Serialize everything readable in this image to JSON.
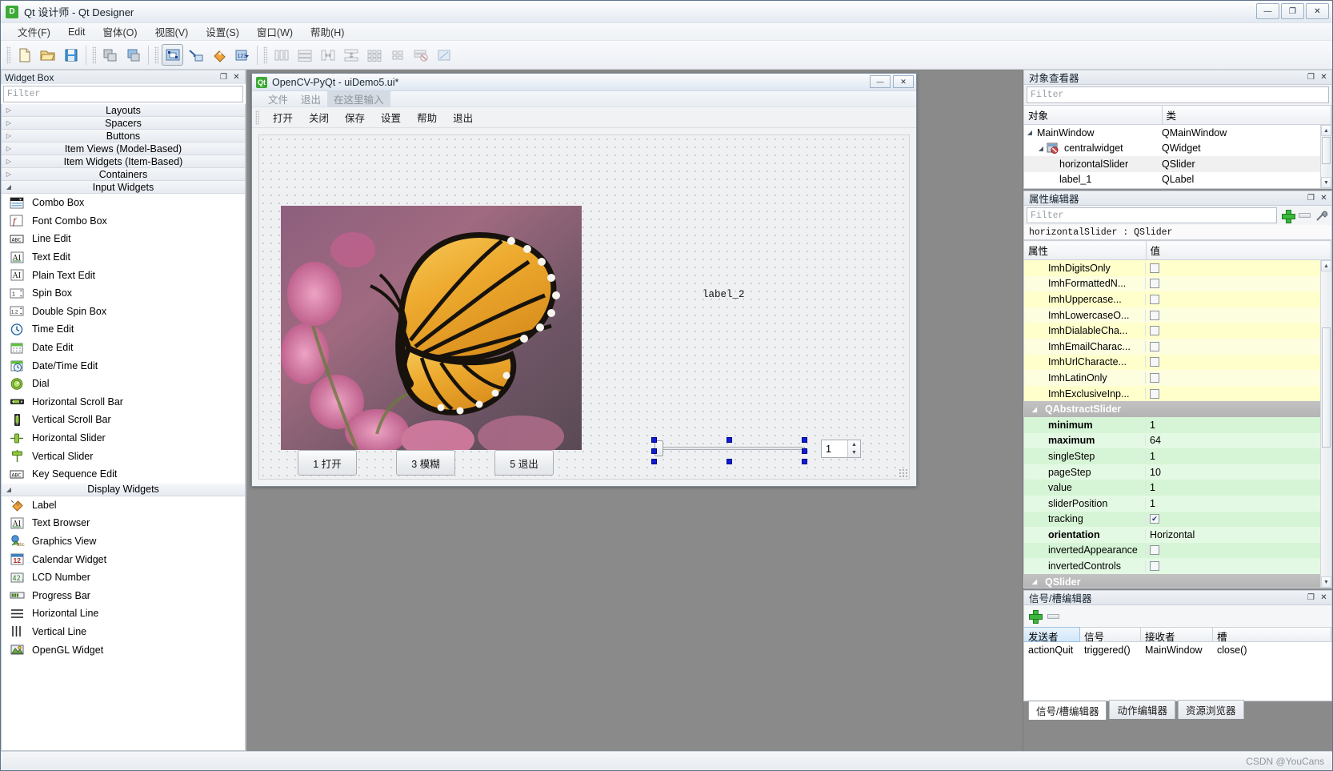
{
  "window": {
    "title": "Qt 设计师 - Qt Designer",
    "logo_text": "D",
    "minimize": "—",
    "maximize": "❐",
    "close": "✕"
  },
  "menubar": {
    "items": [
      {
        "label": "文件(F)"
      },
      {
        "label": "Edit"
      },
      {
        "label": "窗体(O)"
      },
      {
        "label": "视图(V)"
      },
      {
        "label": "设置(S)"
      },
      {
        "label": "窗口(W)"
      },
      {
        "label": "帮助(H)"
      }
    ]
  },
  "toolbar": {
    "icons": [
      "new-form-icon",
      "open-form-icon",
      "save-form-icon",
      "copy-icon",
      "paste-icon",
      "edit-widgets-icon",
      "edit-signals-icon",
      "edit-buddies-icon",
      "edit-tab-order-icon",
      "layout-horizontally-icon",
      "layout-vertically-icon",
      "layout-splitter-h-icon",
      "layout-splitter-v-icon",
      "layout-grid-icon",
      "layout-form-icon",
      "break-layout-icon",
      "adjust-size-icon"
    ]
  },
  "widget_box": {
    "title": "Widget Box",
    "float_btn": "❐",
    "close_btn": "✕",
    "filter_placeholder": "Filter",
    "groups": [
      {
        "label": "Layouts",
        "expanded": false,
        "items": []
      },
      {
        "label": "Spacers",
        "expanded": false,
        "items": []
      },
      {
        "label": "Buttons",
        "expanded": false,
        "items": []
      },
      {
        "label": "Item Views (Model-Based)",
        "expanded": false,
        "items": []
      },
      {
        "label": "Item Widgets (Item-Based)",
        "expanded": false,
        "items": []
      },
      {
        "label": "Containers",
        "expanded": false,
        "items": []
      },
      {
        "label": "Input Widgets",
        "expanded": true,
        "items": [
          {
            "label": "Combo Box",
            "icon": "combo-box-icon"
          },
          {
            "label": "Font Combo Box",
            "icon": "font-combo-box-icon"
          },
          {
            "label": "Line Edit",
            "icon": "line-edit-icon"
          },
          {
            "label": "Text Edit",
            "icon": "text-edit-icon"
          },
          {
            "label": "Plain Text Edit",
            "icon": "plain-text-edit-icon"
          },
          {
            "label": "Spin Box",
            "icon": "spin-box-icon"
          },
          {
            "label": "Double Spin Box",
            "icon": "double-spin-box-icon"
          },
          {
            "label": "Time Edit",
            "icon": "time-edit-icon"
          },
          {
            "label": "Date Edit",
            "icon": "date-edit-icon"
          },
          {
            "label": "Date/Time Edit",
            "icon": "date-time-edit-icon"
          },
          {
            "label": "Dial",
            "icon": "dial-icon"
          },
          {
            "label": "Horizontal Scroll Bar",
            "icon": "horizontal-scroll-bar-icon"
          },
          {
            "label": "Vertical Scroll Bar",
            "icon": "vertical-scroll-bar-icon"
          },
          {
            "label": "Horizontal Slider",
            "icon": "horizontal-slider-icon"
          },
          {
            "label": "Vertical Slider",
            "icon": "vertical-slider-icon"
          },
          {
            "label": "Key Sequence Edit",
            "icon": "key-sequence-edit-icon"
          }
        ]
      },
      {
        "label": "Display Widgets",
        "expanded": true,
        "items": [
          {
            "label": "Label",
            "icon": "label-icon"
          },
          {
            "label": "Text Browser",
            "icon": "text-browser-icon"
          },
          {
            "label": "Graphics View",
            "icon": "graphics-view-icon"
          },
          {
            "label": "Calendar Widget",
            "icon": "calendar-widget-icon"
          },
          {
            "label": "LCD Number",
            "icon": "lcd-number-icon"
          },
          {
            "label": "Progress Bar",
            "icon": "progress-bar-icon"
          },
          {
            "label": "Horizontal Line",
            "icon": "horizontal-line-icon"
          },
          {
            "label": "Vertical Line",
            "icon": "vertical-line-icon"
          },
          {
            "label": "OpenGL Widget",
            "icon": "opengl-widget-icon"
          }
        ]
      }
    ]
  },
  "form_window": {
    "logo_text": "Qt",
    "title": "OpenCV-PyQt - uiDemo5.ui*",
    "minimize": "—",
    "close": "✕",
    "menubar": [
      {
        "label": "文件"
      },
      {
        "label": "退出"
      },
      {
        "label": "在这里输入",
        "placeholder": true
      }
    ],
    "toolbar": [
      {
        "label": "打开"
      },
      {
        "label": "关闭"
      },
      {
        "label": "保存"
      },
      {
        "label": "设置"
      },
      {
        "label": "帮助"
      },
      {
        "label": "退出"
      }
    ],
    "canvas": {
      "image_label_name": "label_1",
      "text_label": "label_2",
      "buttons": [
        {
          "label": "1 打开"
        },
        {
          "label": "3 模糊"
        },
        {
          "label": "5 退出"
        }
      ],
      "spinbox_value": "1",
      "spin_up": "▲",
      "spin_down": "▼"
    }
  },
  "object_inspector": {
    "title": "对象查看器",
    "float_btn": "❐",
    "close_btn": "✕",
    "filter_placeholder": "Filter",
    "columns": [
      "对象",
      "类"
    ],
    "rows": [
      {
        "object": "MainWindow",
        "class": "QMainWindow",
        "depth": 0,
        "twisty": "◢",
        "icon": ""
      },
      {
        "object": "centralwidget",
        "class": "QWidget",
        "depth": 1,
        "twisty": "◢",
        "icon": "widget-icon"
      },
      {
        "object": "horizontalSlider",
        "class": "QSlider",
        "depth": 2,
        "twisty": "",
        "icon": "",
        "selected": true
      },
      {
        "object": "label_1",
        "class": "QLabel",
        "depth": 2,
        "twisty": "",
        "icon": ""
      }
    ]
  },
  "property_editor": {
    "title": "属性编辑器",
    "float_btn": "❐",
    "close_btn": "✕",
    "filter_placeholder": "Filter",
    "selection": "horizontalSlider : QSlider",
    "columns": [
      "属性",
      "值"
    ],
    "tools": [
      "add-property-icon",
      "remove-property-icon",
      "configure-icon"
    ],
    "rows": [
      {
        "name": "ImhDigitsOnly",
        "type": "checkbox",
        "checked": false,
        "group": "imh"
      },
      {
        "name": "ImhFormattedN...",
        "type": "checkbox",
        "checked": false,
        "group": "imh"
      },
      {
        "name": "ImhUppercase...",
        "type": "checkbox",
        "checked": false,
        "group": "imh"
      },
      {
        "name": "ImhLowercaseO...",
        "type": "checkbox",
        "checked": false,
        "group": "imh"
      },
      {
        "name": "ImhDialableCha...",
        "type": "checkbox",
        "checked": false,
        "group": "imh"
      },
      {
        "name": "ImhEmailCharac...",
        "type": "checkbox",
        "checked": false,
        "group": "imh"
      },
      {
        "name": "ImhUrlCharacte...",
        "type": "checkbox",
        "checked": false,
        "group": "imh"
      },
      {
        "name": "ImhLatinOnly",
        "type": "checkbox",
        "checked": false,
        "group": "imh"
      },
      {
        "name": "ImhExclusiveInp...",
        "type": "checkbox",
        "checked": false,
        "group": "imh"
      }
    ],
    "group_header_1": "QAbstractSlider",
    "abstract_slider_rows": [
      {
        "name": "minimum",
        "value": "1",
        "bold": true
      },
      {
        "name": "maximum",
        "value": "64",
        "bold": true
      },
      {
        "name": "singleStep",
        "value": "1",
        "bold": false
      },
      {
        "name": "pageStep",
        "value": "10",
        "bold": false
      },
      {
        "name": "value",
        "value": "1",
        "bold": false
      },
      {
        "name": "sliderPosition",
        "value": "1",
        "bold": false
      },
      {
        "name": "tracking",
        "type": "checkbox",
        "checked": true,
        "bold": false
      },
      {
        "name": "orientation",
        "value": "Horizontal",
        "bold": true
      },
      {
        "name": "invertedAppearance",
        "type": "checkbox",
        "checked": false,
        "bold": false
      },
      {
        "name": "invertedControls",
        "type": "checkbox",
        "checked": false,
        "bold": false
      }
    ],
    "group_header_2": "QSlider",
    "twisty": "◢"
  },
  "signal_slot_editor": {
    "title": "信号/槽编辑器",
    "float_btn": "❐",
    "close_btn": "✕",
    "add_icon": "add-connection-icon",
    "remove_icon": "remove-connection-icon",
    "columns": [
      "发送者",
      "信号",
      "接收者",
      "槽"
    ],
    "rows": [
      {
        "sender": "actionQuit",
        "signal": "triggered()",
        "receiver": "MainWindow",
        "slot": "close()"
      }
    ]
  },
  "bottom_tabs": [
    {
      "label": "信号/槽编辑器",
      "active": true
    },
    {
      "label": "动作编辑器",
      "active": false
    },
    {
      "label": "资源浏览器",
      "active": false
    }
  ],
  "statusbar": {
    "watermark": "CSDN @YouCans"
  },
  "colors": {
    "accent_green": "#3daa35",
    "selection_blue": "#0b1fd0",
    "property_yellow": "#ffffcc",
    "property_green": "#d6f5d6",
    "group_gray": "#b9b9b9"
  }
}
